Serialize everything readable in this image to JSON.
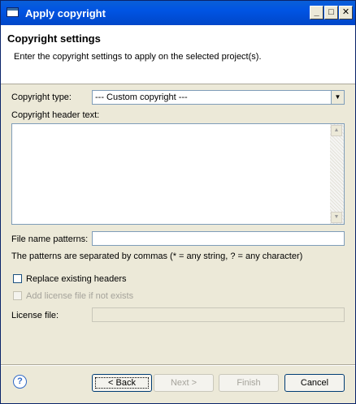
{
  "window": {
    "title": "Apply copyright",
    "controls": {
      "minimize": "_",
      "maximize": "□",
      "close": "✕"
    }
  },
  "banner": {
    "title": "Copyright settings",
    "description": "Enter the copyright settings to apply on the selected project(s)."
  },
  "form": {
    "copyright_type_label": "Copyright type:",
    "copyright_type_value": "--- Custom copyright ---",
    "header_text_label": "Copyright header text:",
    "header_text_value": "",
    "file_patterns_label": "File name patterns:",
    "file_patterns_value": "",
    "patterns_hint": "The patterns are separated by commas (* = any string, ? = any character)",
    "replace_headers_label": "Replace existing headers",
    "replace_headers_checked": false,
    "add_license_label": "Add license file if not exists",
    "add_license_checked": false,
    "license_file_label": "License file:",
    "license_file_value": ""
  },
  "buttons": {
    "help": "?",
    "back": "< Back",
    "next": "Next >",
    "finish": "Finish",
    "cancel": "Cancel"
  },
  "icons": {
    "window_icon": "window-icon",
    "combo_arrow": "chevron-down-icon",
    "scroll_up": "scroll-up-icon",
    "scroll_down": "scroll-down-icon",
    "help": "help-icon"
  },
  "colors": {
    "titlebar": "#0054e3",
    "dialog_bg": "#ece9d8",
    "field_border": "#7f9db9",
    "disabled_text": "#a5a39b"
  }
}
